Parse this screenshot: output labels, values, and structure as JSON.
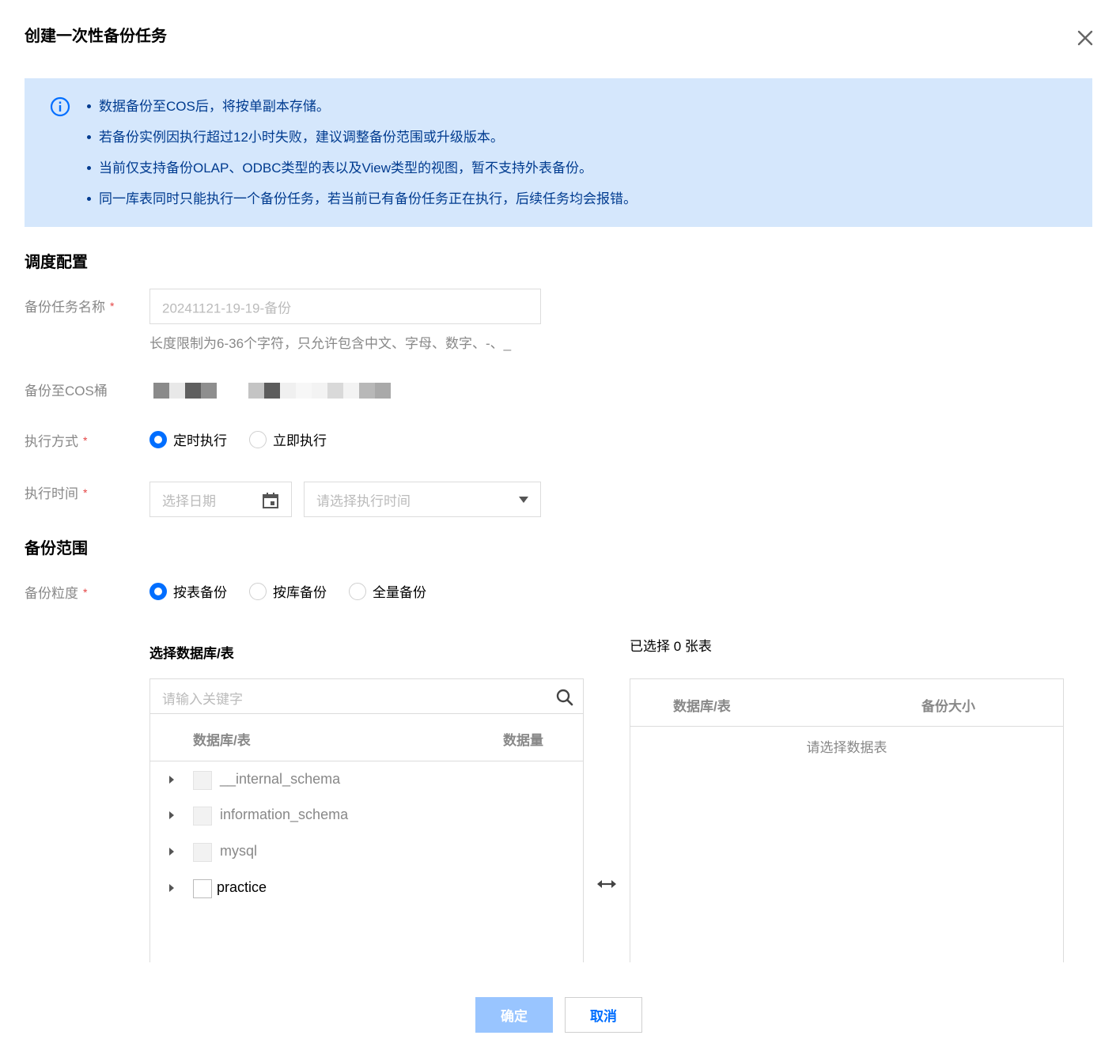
{
  "dialog": {
    "title": "创建一次性备份任务"
  },
  "notice": {
    "items": [
      "数据备份至COS后，将按单副本存储。",
      "若备份实例因执行超过12小时失败，建议调整备份范围或升级版本。",
      "当前仅支持备份OLAP、ODBC类型的表以及View类型的视图，暂不支持外表备份。",
      "同一库表同时只能执行一个备份任务，若当前已有备份任务正在执行，后续任务均会报错。"
    ]
  },
  "schedule": {
    "heading": "调度配置",
    "task_name_label": "备份任务名称",
    "task_name_placeholder": "20241121-19-19-备份",
    "task_name_hint": "长度限制为6-36个字符，只允许包含中文、字母、数字、-、_",
    "cos_label": "备份至COS桶",
    "mode_label": "执行方式",
    "mode_options": [
      "定时执行",
      "立即执行"
    ],
    "mode_selected": "定时执行",
    "time_label": "执行时间",
    "date_placeholder": "选择日期",
    "time_placeholder": "请选择执行时间"
  },
  "scope": {
    "heading": "备份范围",
    "granularity_label": "备份粒度",
    "granularity_options": [
      "按表备份",
      "按库备份",
      "全量备份"
    ],
    "granularity_selected": "按表备份",
    "source": {
      "title": "选择数据库/表",
      "search_placeholder": "请输入关键字",
      "col_name": "数据库/表",
      "col_size": "数据量",
      "rows": [
        "__internal_schema",
        "information_schema",
        "mysql",
        "practice"
      ]
    },
    "target": {
      "title": "已选择 0 张表",
      "col_name": "数据库/表",
      "col_size": "备份大小",
      "empty": "请选择数据表"
    }
  },
  "footer": {
    "confirm": "确定",
    "cancel": "取消"
  },
  "colors": {
    "accent": "#006eff",
    "notice_bg": "#d5e7fc",
    "notice_text": "#003b8f",
    "required": "#e54545"
  }
}
